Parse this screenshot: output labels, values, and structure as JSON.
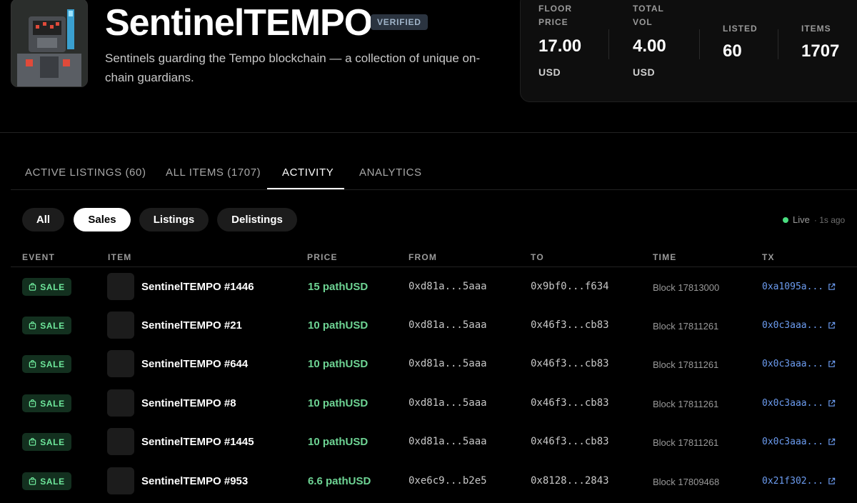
{
  "collection": {
    "title": "SentinelTEMPO",
    "badge": "VERIFIED",
    "description": "Sentinels guarding the Tempo blockchain — a collection of unique on-chain guardians."
  },
  "stats": {
    "floor": {
      "label_line1": "FLOOR",
      "label_line2": "PRICE",
      "value": "17.00",
      "unit": "USD"
    },
    "volume": {
      "label_line1": "TOTAL",
      "label_line2": "VOL",
      "value": "4.00",
      "unit": "USD"
    },
    "listed": {
      "label": "LISTED",
      "value": "60"
    },
    "items": {
      "label": "ITEMS",
      "value": "1707"
    }
  },
  "tabs": [
    {
      "label": "ACTIVE LISTINGS (60)",
      "active": false
    },
    {
      "label": "ALL ITEMS (1707)",
      "active": false
    },
    {
      "label": "ACTIVITY",
      "active": true
    },
    {
      "label": "ANALYTICS",
      "active": false
    }
  ],
  "filters": [
    {
      "label": "All",
      "active": false
    },
    {
      "label": "Sales",
      "active": true
    },
    {
      "label": "Listings",
      "active": false
    },
    {
      "label": "Delistings",
      "active": false
    }
  ],
  "live": {
    "label": "Live",
    "ago": "· 1s ago",
    "color": "#4ade80"
  },
  "table": {
    "headers": [
      "EVENT",
      "ITEM",
      "PRICE",
      "FROM",
      "TO",
      "TIME",
      "TX"
    ],
    "rows": [
      {
        "event": "SALE",
        "item": "SentinelTEMPO #1446",
        "price": "15 pathUSD",
        "from": "0xd81a...5aaa",
        "to": "0x9bf0...f634",
        "time": "Block 17813000",
        "tx": "0xa1095a..."
      },
      {
        "event": "SALE",
        "item": "SentinelTEMPO #21",
        "price": "10 pathUSD",
        "from": "0xd81a...5aaa",
        "to": "0x46f3...cb83",
        "time": "Block 17811261",
        "tx": "0x0c3aaa..."
      },
      {
        "event": "SALE",
        "item": "SentinelTEMPO #644",
        "price": "10 pathUSD",
        "from": "0xd81a...5aaa",
        "to": "0x46f3...cb83",
        "time": "Block 17811261",
        "tx": "0x0c3aaa..."
      },
      {
        "event": "SALE",
        "item": "SentinelTEMPO #8",
        "price": "10 pathUSD",
        "from": "0xd81a...5aaa",
        "to": "0x46f3...cb83",
        "time": "Block 17811261",
        "tx": "0x0c3aaa..."
      },
      {
        "event": "SALE",
        "item": "SentinelTEMPO #1445",
        "price": "10 pathUSD",
        "from": "0xd81a...5aaa",
        "to": "0x46f3...cb83",
        "time": "Block 17811261",
        "tx": "0x0c3aaa..."
      },
      {
        "event": "SALE",
        "item": "SentinelTEMPO #953",
        "price": "6.6 pathUSD",
        "from": "0xe6c9...b2e5",
        "to": "0x8128...2843",
        "time": "Block 17809468",
        "tx": "0x21f302..."
      }
    ]
  },
  "icons": {
    "badge": "bag-icon",
    "tx": "external-link-icon"
  },
  "colors": {
    "accent_green": "#6ed494",
    "link_blue": "#6c9cf0",
    "sale_badge_bg": "#13301f"
  }
}
